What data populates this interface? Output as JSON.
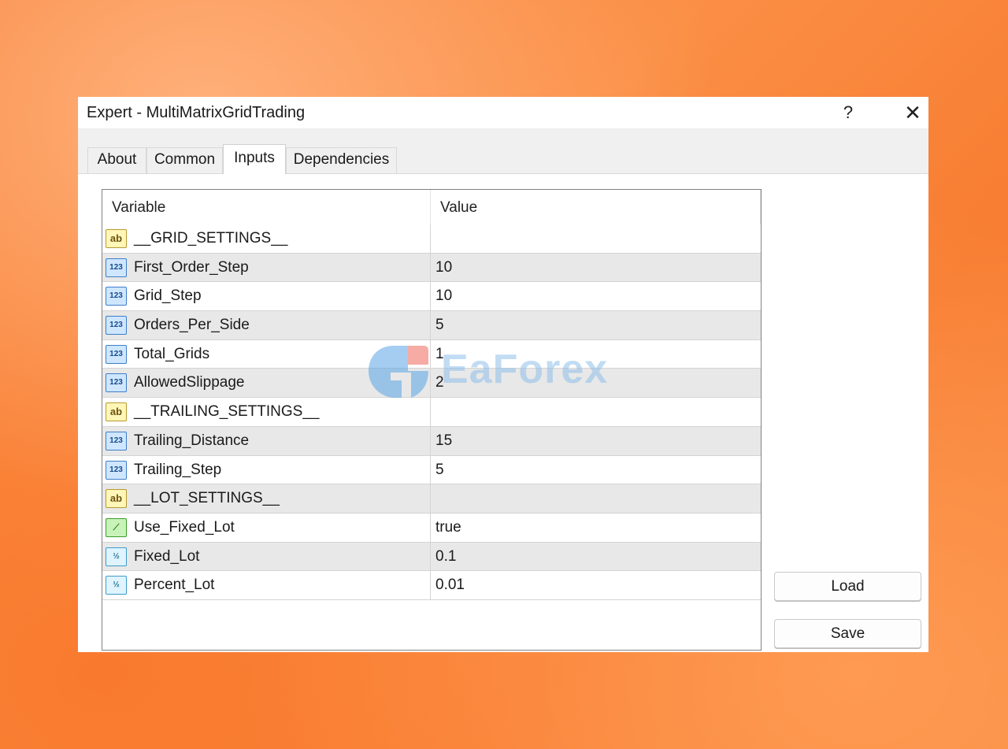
{
  "window": {
    "title": "Expert - MultiMatrixGridTrading",
    "help": "?",
    "close": "✕"
  },
  "tabs": [
    {
      "label": "About"
    },
    {
      "label": "Common"
    },
    {
      "label": "Inputs"
    },
    {
      "label": "Dependencies"
    }
  ],
  "active_tab": "Inputs",
  "grid": {
    "headers": {
      "variable": "Variable",
      "value": "Value"
    },
    "rows": [
      {
        "type": "string",
        "name": "__GRID_SETTINGS__",
        "value": ""
      },
      {
        "type": "int",
        "name": "First_Order_Step",
        "value": "10"
      },
      {
        "type": "int",
        "name": "Grid_Step",
        "value": "10"
      },
      {
        "type": "int",
        "name": "Orders_Per_Side",
        "value": "5"
      },
      {
        "type": "int",
        "name": "Total_Grids",
        "value": "1"
      },
      {
        "type": "int",
        "name": "AllowedSlippage",
        "value": "2"
      },
      {
        "type": "string",
        "name": "__TRAILING_SETTINGS__",
        "value": ""
      },
      {
        "type": "int",
        "name": "Trailing_Distance",
        "value": "15"
      },
      {
        "type": "int",
        "name": "Trailing_Step",
        "value": "5"
      },
      {
        "type": "string",
        "name": "__LOT_SETTINGS__",
        "value": ""
      },
      {
        "type": "bool",
        "name": "Use_Fixed_Lot",
        "value": "true"
      },
      {
        "type": "double",
        "name": "Fixed_Lot",
        "value": "0.1"
      },
      {
        "type": "double",
        "name": "Percent_Lot",
        "value": "0.01"
      }
    ]
  },
  "icons": {
    "string": "ab",
    "int": "123",
    "bool": "⟋",
    "double": "½"
  },
  "buttons": {
    "load": "Load",
    "save": "Save"
  },
  "watermark": {
    "text": "EaForex"
  },
  "colors": {
    "background": "#f7823a",
    "window": "#f0f0f0",
    "watermark": "#8fc0ea"
  }
}
